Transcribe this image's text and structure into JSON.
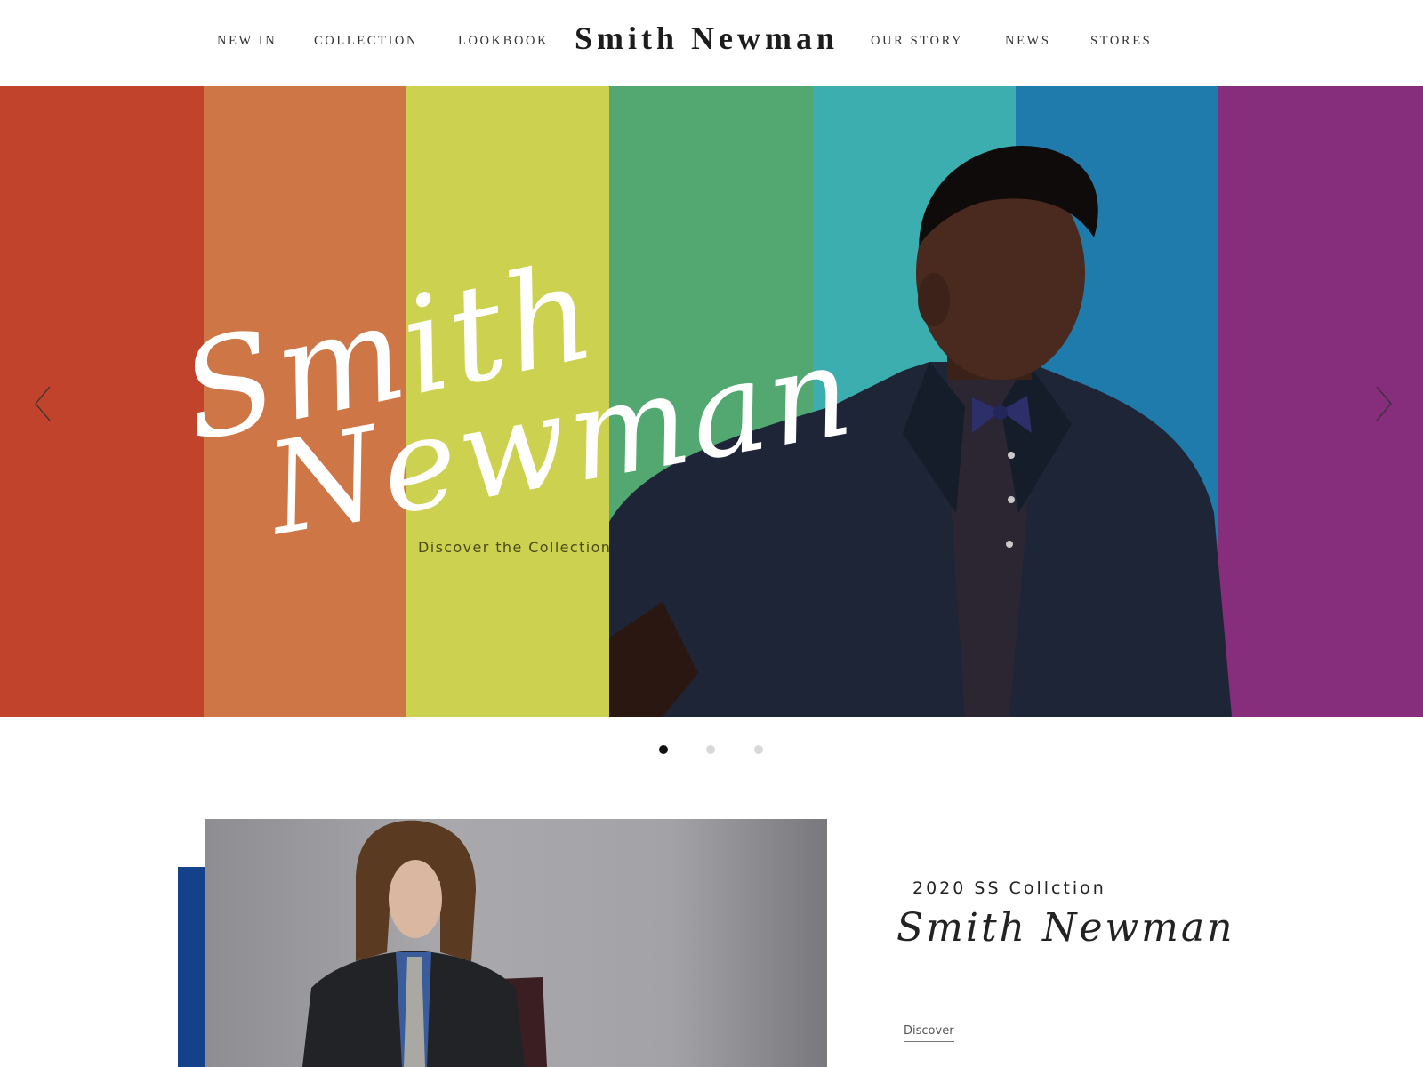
{
  "header": {
    "brand": "Smith Newman",
    "nav_left": [
      "NEW IN",
      "COLLECTION",
      "LOOKBOOK"
    ],
    "nav_right": [
      "OUR STORY",
      "NEWS",
      "STORES"
    ]
  },
  "hero": {
    "script_line1": "Smith",
    "script_line2": "Newman",
    "cta": "Discover the Collection",
    "stripe_colors": [
      "#c2432b",
      "#ce7645",
      "#cdd150",
      "#52a870",
      "#3daeb0",
      "#207bad",
      "#862d7b"
    ],
    "prev_icon": "chevron-left-icon",
    "next_icon": "chevron-right-icon"
  },
  "carousel": {
    "slides": 3,
    "active_index": 0
  },
  "feature": {
    "subtitle": "2020 SS Collction",
    "title": "Smith Newman",
    "link": "Discover",
    "accent_color": "#13428b"
  }
}
